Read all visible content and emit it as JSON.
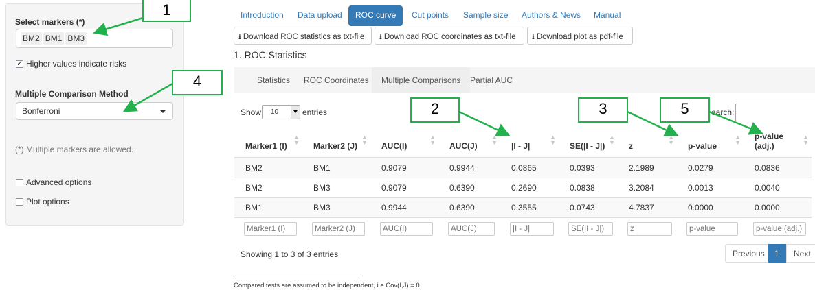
{
  "sidebar": {
    "markers_label": "Select markers (*)",
    "markers": [
      "BM2",
      "BM1",
      "BM3"
    ],
    "risk_checkbox_label": "Higher values indicate risks",
    "risk_checked": true,
    "method_label": "Multiple Comparison Method",
    "method_value": "Bonferroni",
    "note": "(*) Multiple markers are allowed.",
    "advanced_label": "Advanced options",
    "plot_options_label": "Plot options"
  },
  "tabs": [
    "Introduction",
    "Data upload",
    "ROC curve",
    "Cut points",
    "Sample size",
    "Authors & News",
    "Manual"
  ],
  "active_tab": "ROC curve",
  "downloads": [
    "Download ROC statistics as txt-file",
    "Download ROC coordinates as txt-file",
    "Download plot as pdf-file"
  ],
  "section_title": "1. ROC Statistics",
  "subtabs": [
    "Statistics",
    "ROC Coordinates",
    "Multiple Comparisons",
    "Partial AUC"
  ],
  "active_subtab": "Multiple Comparisons",
  "length": {
    "show": "Show",
    "value": "10",
    "entries": "entries"
  },
  "search_label": "earch:",
  "table": {
    "headers": [
      "Marker1 (I)",
      "Marker2 (J)",
      "AUC(I)",
      "AUC(J)",
      "|I - J|",
      "SE(|I - J|)",
      "z",
      "p-value",
      "p-value\n(adj.)"
    ],
    "rows": [
      [
        "BM2",
        "BM1",
        "0.9079",
        "0.9944",
        "0.0865",
        "0.0393",
        "2.1989",
        "0.0279",
        "0.0836"
      ],
      [
        "BM2",
        "BM3",
        "0.9079",
        "0.6390",
        "0.2690",
        "0.0838",
        "3.2084",
        "0.0013",
        "0.0040"
      ],
      [
        "BM1",
        "BM3",
        "0.9944",
        "0.6390",
        "0.3555",
        "0.0743",
        "4.7837",
        "0.0000",
        "0.0000"
      ]
    ],
    "filter_placeholders": [
      "Marker1 (I)",
      "Marker2 (J)",
      "AUC(I)",
      "AUC(J)",
      "|I - J|",
      "SE(|I - J|)",
      "z",
      "p-value",
      "p-value (adj.)"
    ]
  },
  "info": "Showing 1 to 3 of 3 entries",
  "pager": {
    "previous": "Previous",
    "page": "1",
    "next": "Next"
  },
  "footnote": "Compared tests are assumed to be independent, i.e Cov(I,J) = 0.",
  "annotations": [
    "1",
    "2",
    "3",
    "4",
    "5"
  ],
  "colors": {
    "accent": "#337ab7",
    "callout": "#22b14c"
  }
}
